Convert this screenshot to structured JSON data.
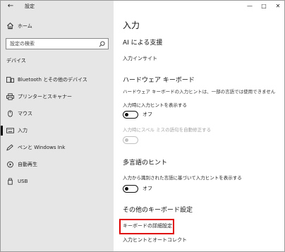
{
  "window": {
    "title": "設定",
    "controls": {
      "minimize": "—",
      "maximize": "□",
      "close": "✕"
    }
  },
  "sidebar": {
    "home_label": "ホーム",
    "search_placeholder": "設定の検索",
    "section_title": "デバイス",
    "items": [
      {
        "label": "Bluetooth とその他のデバイス",
        "icon": "bluetooth-devices-icon",
        "selected": false
      },
      {
        "label": "プリンターとスキャナー",
        "icon": "printer-icon",
        "selected": false
      },
      {
        "label": "マウス",
        "icon": "mouse-icon",
        "selected": false
      },
      {
        "label": "入力",
        "icon": "keyboard-icon",
        "selected": true
      },
      {
        "label": "ペンと Windows Ink",
        "icon": "pen-icon",
        "selected": false
      },
      {
        "label": "自動再生",
        "icon": "autoplay-icon",
        "selected": false
      },
      {
        "label": "USB",
        "icon": "usb-icon",
        "selected": false
      }
    ]
  },
  "main": {
    "page_title": "入力",
    "ai_section": {
      "heading": "AI による支援",
      "link": "入力インサイト"
    },
    "hardware_keyboard": {
      "heading": "ハードウェア キーボード",
      "description": "ハードウェア キーボードの入力ヒントは、一部の言語では使用できません",
      "setting1_label": "入力時に入力ヒントを表示する",
      "setting1_state": "オフ",
      "setting1_on": false,
      "setting2_label": "入力時にスペル ミスの語句を自動修正する",
      "setting2_enabled": false
    },
    "multilingual": {
      "heading": "多言語のヒント",
      "setting_label": "入力から識別された言語に基づいて入力ヒントを表示する",
      "setting_state": "オフ",
      "setting_on": false
    },
    "other_keyboard": {
      "heading": "その他のキーボード設定",
      "link_advanced": "キーボードの詳細設定",
      "link_autocorrect": "入力ヒントとオートコレクト"
    }
  },
  "colors": {
    "sidebar_bg": "#e6e6e6",
    "highlight": "#e00000",
    "toggle_off": "#111111",
    "disabled": "#c2c2c2"
  }
}
